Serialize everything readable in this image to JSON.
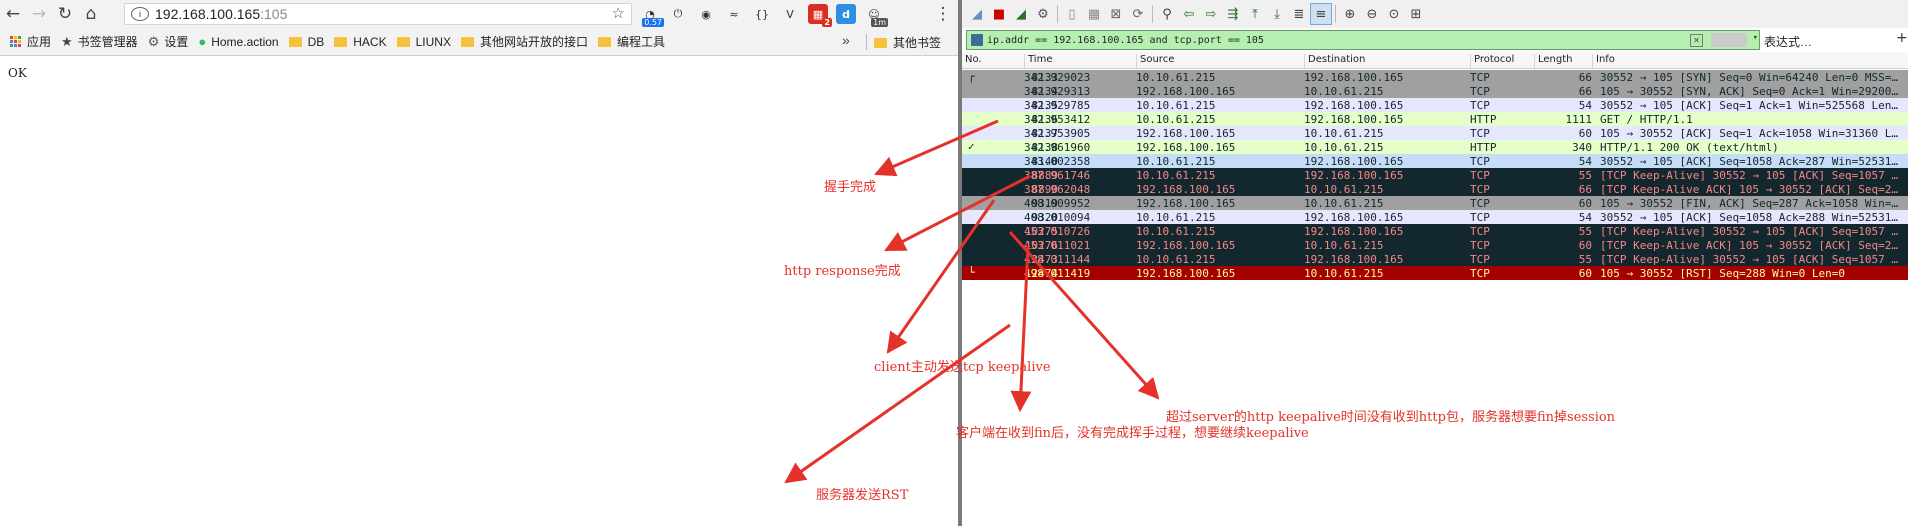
{
  "browser": {
    "url_host": "192.168.100.165",
    "url_port": ":105",
    "extensions": [
      {
        "icon": "speed-gauge-icon",
        "badge": "0.57",
        "color": "#1a73e8"
      },
      {
        "icon": "power-icon",
        "badge": "",
        "color": ""
      },
      {
        "icon": "ring-icon",
        "badge": "",
        "color": ""
      },
      {
        "icon": "translate-icon",
        "badge": "",
        "color": ""
      },
      {
        "icon": "code-icon",
        "badge": "",
        "color": ""
      },
      {
        "icon": "v-icon",
        "badge": "",
        "color": ""
      },
      {
        "icon": "grid-icon",
        "badge": "2",
        "color": "#d93025"
      },
      {
        "icon": "d-icon",
        "badge": "",
        "color": "#2f8de4"
      },
      {
        "icon": "person-icon",
        "badge": "1m",
        "color": ""
      }
    ],
    "bookmarks": [
      {
        "label": "应用",
        "icon": "apps-icon"
      },
      {
        "label": "书签管理器",
        "icon": "star-icon"
      },
      {
        "label": "设置",
        "icon": "gear-icon"
      },
      {
        "label": "Home.action",
        "icon": "evernote-icon"
      },
      {
        "label": "DB",
        "icon": "folder-icon"
      },
      {
        "label": "HACK",
        "icon": "folder-icon"
      },
      {
        "label": "LIUNX",
        "icon": "folder-icon"
      },
      {
        "label": "其他网站开放的接口",
        "icon": "folder-icon"
      },
      {
        "label": "编程工具",
        "icon": "folder-icon"
      }
    ],
    "bookmarks_more": "»",
    "other_bookmarks": "其他书签",
    "page_text": "OK"
  },
  "wireshark": {
    "filter": "ip.addr == 192.168.100.165 and tcp.port == 105",
    "expression_label": "表达式…",
    "plus_label": "+",
    "columns": {
      "no": "No.",
      "time": "Time",
      "source": "Source",
      "destination": "Destination",
      "protocol": "Protocol",
      "length": "Length",
      "info": "Info"
    },
    "rows": [
      {
        "no": "8133",
        "time": "342.929023",
        "src": "10.10.61.215",
        "dst": "192.168.100.165",
        "proto": "TCP",
        "len": "66",
        "info": "30552 → 105 [SYN] Seq=0 Win=64240 Len=0 MSS=…",
        "bg": "#a0a0a0",
        "fg": "#12272e",
        "mark": "┌"
      },
      {
        "no": "8134",
        "time": "342.929313",
        "src": "192.168.100.165",
        "dst": "10.10.61.215",
        "proto": "TCP",
        "len": "66",
        "info": "105 → 30552 [SYN, ACK] Seq=0 Ack=1 Win=29200…",
        "bg": "#a0a0a0",
        "fg": "#12272e",
        "mark": ""
      },
      {
        "no": "8135",
        "time": "342.929785",
        "src": "10.10.61.215",
        "dst": "192.168.100.165",
        "proto": "TCP",
        "len": "54",
        "info": "30552 → 105 [ACK] Seq=1 Ack=1 Win=525568 Len…",
        "bg": "#e7e6ff",
        "fg": "#12272e",
        "mark": ""
      },
      {
        "no": "8136",
        "time": "342.953412",
        "src": "10.10.61.215",
        "dst": "192.168.100.165",
        "proto": "HTTP",
        "len": "1111",
        "info": "GET / HTTP/1.1",
        "bg": "#e4ffc7",
        "fg": "#12272e",
        "mark": ""
      },
      {
        "no": "8137",
        "time": "342.953905",
        "src": "192.168.100.165",
        "dst": "10.10.61.215",
        "proto": "TCP",
        "len": "60",
        "info": "105 → 30552 [ACK] Seq=1 Ack=1058 Win=31360 L…",
        "bg": "#e7e6ff",
        "fg": "#12272e",
        "mark": ""
      },
      {
        "no": "8138",
        "time": "342.961960",
        "src": "192.168.100.165",
        "dst": "10.10.61.215",
        "proto": "HTTP",
        "len": "340",
        "info": "HTTP/1.1 200 OK  (text/html)",
        "bg": "#e4ffc7",
        "fg": "#12272e",
        "mark": "✓"
      },
      {
        "no": "8140",
        "time": "343.002358",
        "src": "10.10.61.215",
        "dst": "192.168.100.165",
        "proto": "TCP",
        "len": "54",
        "info": "30552 → 105 [ACK] Seq=1058 Ack=287 Win=52531…",
        "bg": "#c6dcf7",
        "fg": "#12272e",
        "mark": ""
      },
      {
        "no": "8889",
        "time": "387.961746",
        "src": "10.10.61.215",
        "dst": "192.168.100.165",
        "proto": "TCP",
        "len": "55",
        "info": "[TCP Keep-Alive] 30552 → 105 [ACK] Seq=1057 …",
        "bg": "#12272e",
        "fg": "#f78787",
        "mark": ""
      },
      {
        "no": "8890",
        "time": "387.962048",
        "src": "192.168.100.165",
        "dst": "10.10.61.215",
        "proto": "TCP",
        "len": "66",
        "info": "[TCP Keep-Alive ACK] 105 → 30552 [ACK] Seq=2…",
        "bg": "#12272e",
        "fg": "#f78787",
        "mark": ""
      },
      {
        "no": "9319",
        "time": "408.009952",
        "src": "192.168.100.165",
        "dst": "10.10.61.215",
        "proto": "TCP",
        "len": "60",
        "info": "105 → 30552 [FIN, ACK] Seq=287 Ack=1058 Win=…",
        "bg": "#a0a0a0",
        "fg": "#12272e",
        "mark": ""
      },
      {
        "no": "9320",
        "time": "408.010094",
        "src": "10.10.61.215",
        "dst": "192.168.100.165",
        "proto": "TCP",
        "len": "54",
        "info": "30552 → 105 [ACK] Seq=1058 Ack=288 Win=52531…",
        "bg": "#e7e6ff",
        "fg": "#12272e",
        "mark": ""
      },
      {
        "no": "10275",
        "time": "453.010726",
        "src": "10.10.61.215",
        "dst": "192.168.100.165",
        "proto": "TCP",
        "len": "55",
        "info": "[TCP Keep-Alive] 30552 → 105 [ACK] Seq=1057 …",
        "bg": "#12272e",
        "fg": "#f78787",
        "mark": ""
      },
      {
        "no": "10276",
        "time": "453.011021",
        "src": "192.168.100.165",
        "dst": "10.10.61.215",
        "proto": "TCP",
        "len": "60",
        "info": "[TCP Keep-Alive ACK] 105 → 30552 [ACK] Seq=2…",
        "bg": "#12272e",
        "fg": "#f78787",
        "mark": ""
      },
      {
        "no": "12473",
        "time": "498.011144",
        "src": "10.10.61.215",
        "dst": "192.168.100.165",
        "proto": "TCP",
        "len": "55",
        "info": "[TCP Keep-Alive] 30552 → 105 [ACK] Seq=1057 …",
        "bg": "#12272e",
        "fg": "#f78787",
        "mark": ""
      },
      {
        "no": "12474",
        "time": "498.011419",
        "src": "192.168.100.165",
        "dst": "10.10.61.215",
        "proto": "TCP",
        "len": "60",
        "info": "105 → 30552 [RST] Seq=288 Win=0 Len=0",
        "bg": "#a40000",
        "fg": "#fffc9c",
        "mark": "└"
      }
    ]
  },
  "annotations": [
    {
      "text": "握手完成"
    },
    {
      "text": "http response完成"
    },
    {
      "text": "client主动发送tcp keepalive"
    },
    {
      "text": "超过server的http keepalive时间没有收到http包，服务器想要fin掉session"
    },
    {
      "text": "客户端在收到fin后，没有完成挥手过程，想要继续keepalive"
    },
    {
      "text": "服务器发送RST"
    }
  ],
  "colors": {
    "annotation": "#e4322b",
    "filter_ok": "#b6f0b0"
  }
}
